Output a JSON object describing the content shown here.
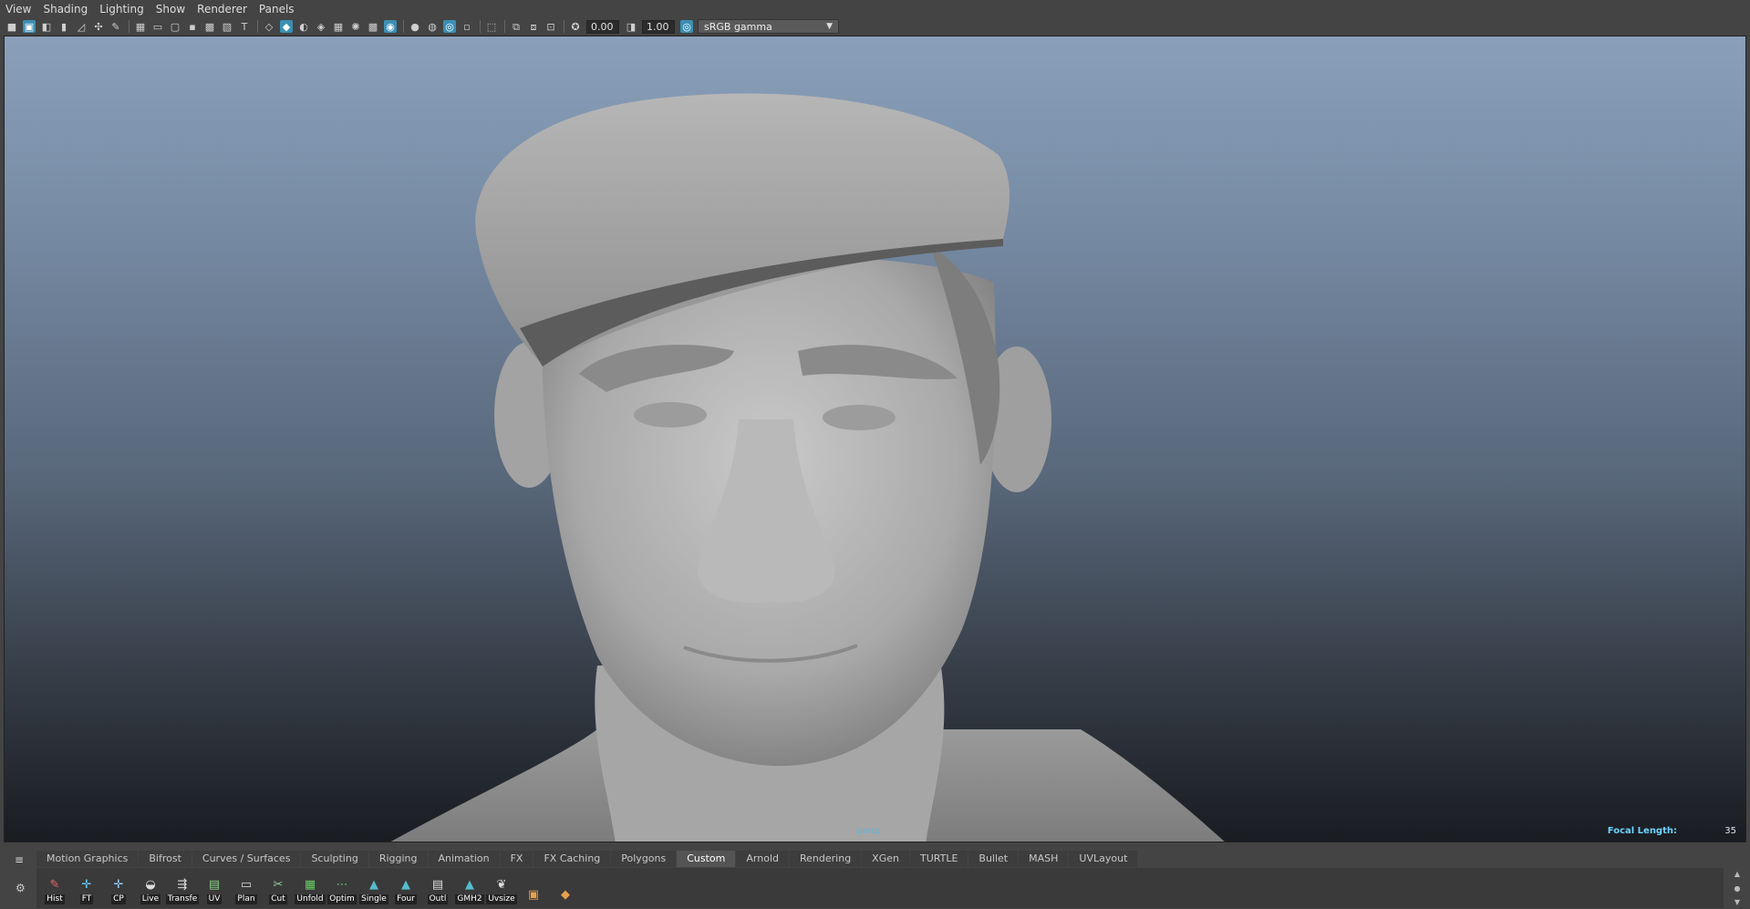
{
  "menu": [
    "View",
    "Shading",
    "Lighting",
    "Show",
    "Renderer",
    "Panels"
  ],
  "toolbar": {
    "exposure_value": "0.00",
    "gamma_value": "1.00",
    "color_space": "sRGB gamma"
  },
  "viewport": {
    "focal_length_label": "Focal Length:",
    "focal_length_value": "35",
    "camera_label": "persp"
  },
  "shelf": {
    "tabs": [
      "Motion Graphics",
      "Bifrost",
      "Curves / Surfaces",
      "Sculpting",
      "Rigging",
      "Animation",
      "FX",
      "FX Caching",
      "Polygons",
      "Custom",
      "Arnold",
      "Rendering",
      "XGen",
      "TURTLE",
      "Bullet",
      "MASH",
      "UVLayout"
    ],
    "active_tab": "Custom",
    "buttons": [
      "Hist",
      "FT",
      "CP",
      "Live",
      "Transfe",
      "UV",
      "Plan",
      "Cut",
      "Unfold",
      "Optim",
      "Single",
      "Four",
      "Outl",
      "GMH2",
      "Uvsize",
      "",
      ""
    ]
  },
  "colors": {
    "accent": "#3b8fb3",
    "focal_label": "#6fd3ff",
    "viewport_top": "#8aa0ba",
    "viewport_bottom": "#191c21"
  }
}
